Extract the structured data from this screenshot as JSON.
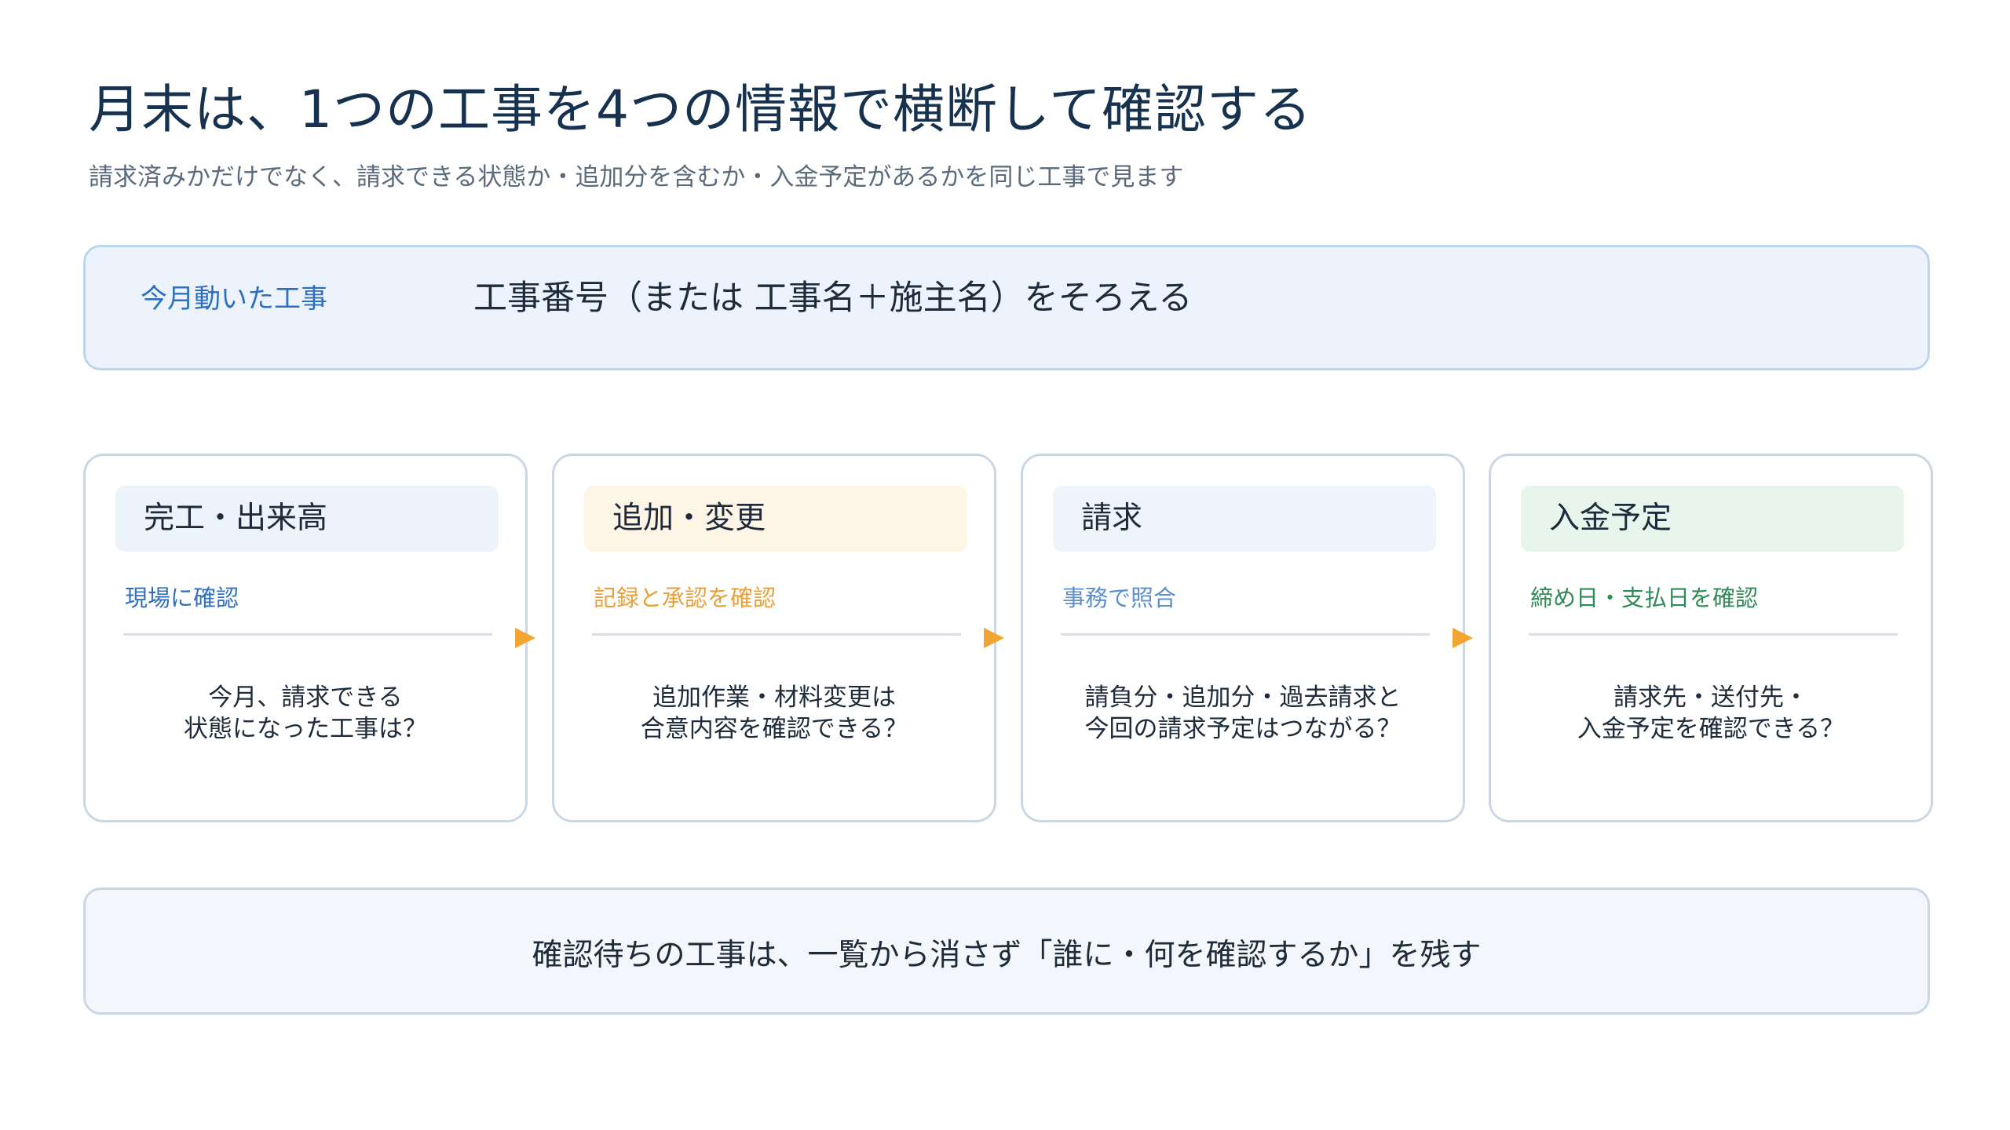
{
  "header": {
    "title": "月末は、1つの工事を4つの情報で横断して確認する",
    "subtitle": "請求済みかだけでなく、請求できる状態か・追加分を含むか・入金予定があるかを同じ工事で見ます"
  },
  "top_band": {
    "label": "今月動いた工事",
    "text": "工事番号（または 工事名＋施主名）をそろえる"
  },
  "cards": [
    {
      "title": "完工・出来高",
      "subtitle": "現場に確認",
      "question_lines": [
        "今月、請求できる",
        "状態になった工事は？"
      ],
      "head_bg": "#edf3fb",
      "subtitle_color": "#2f6fc0"
    },
    {
      "title": "追加・変更",
      "subtitle": "記録と承認を確認",
      "question_lines": [
        "追加作業・材料変更は",
        "合意内容を確認できる？"
      ],
      "head_bg": "#fff5e6",
      "subtitle_color": "#e8a13a"
    },
    {
      "title": "請求",
      "subtitle": "事務で照合",
      "question_lines": [
        "請負分・追加分・過去請求と",
        "今回の請求予定はつながる？"
      ],
      "head_bg": "#edf4fc",
      "subtitle_color": "#5b8fd0"
    },
    {
      "title": "入金予定",
      "subtitle": "締め日・支払日を確認",
      "question_lines": [
        "請求先・送付先・",
        "入金予定を確認できる？"
      ],
      "head_bg": "#e8f5ec",
      "subtitle_color": "#2f8a57"
    }
  ],
  "arrow_color": "#f2a531",
  "bottom_band": {
    "text": "確認待ちの工事は、一覧から消さず「誰に・何を確認するか」を残す"
  }
}
